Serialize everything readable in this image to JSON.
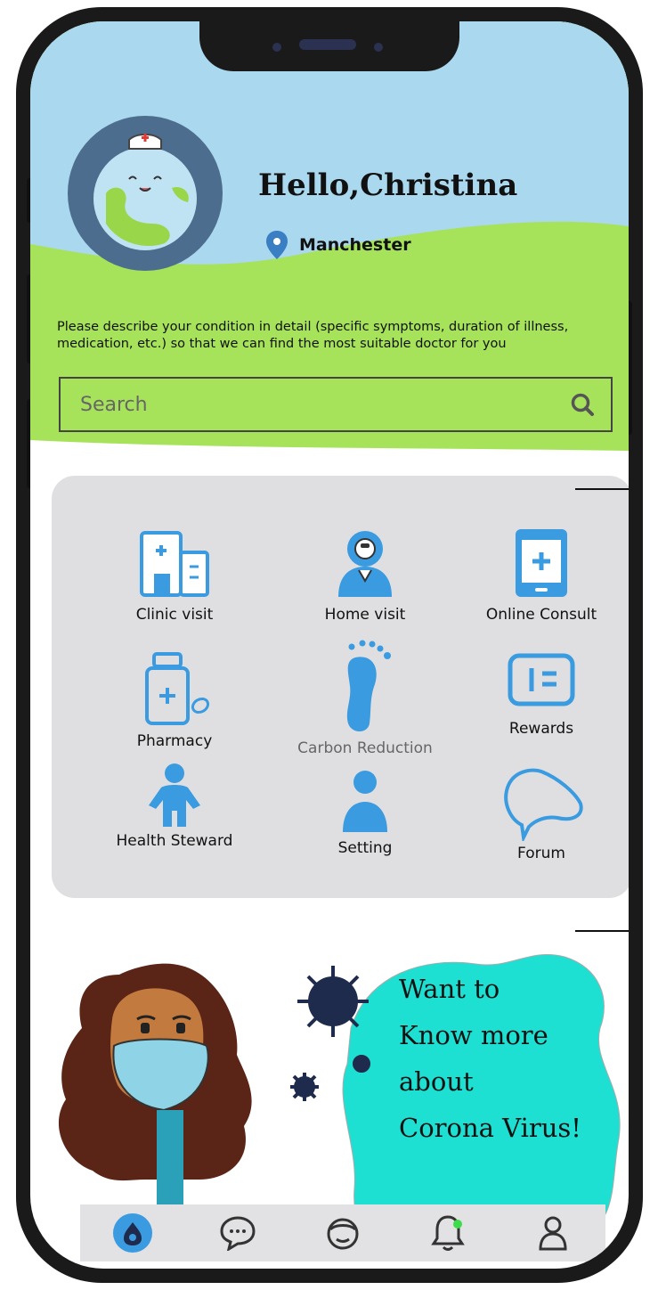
{
  "header": {
    "greeting": "Hello,Christina",
    "location": "Manchester",
    "description": "Please describe your condition in detail (specific symptoms, duration of illness, medication, etc.) so that we can find the most suitable doctor for you"
  },
  "search": {
    "placeholder": "Search"
  },
  "services": [
    {
      "label": "Clinic visit",
      "icon": "clinic-icon"
    },
    {
      "label": "Home visit",
      "icon": "doctor-icon"
    },
    {
      "label": "Online Consult",
      "icon": "tablet-icon"
    },
    {
      "label": "Pharmacy",
      "icon": "medicine-bottle-icon"
    },
    {
      "label": "Carbon Reduction",
      "icon": "footprint-icon"
    },
    {
      "label": "Rewards",
      "icon": "rewards-icon"
    },
    {
      "label": "Health Steward",
      "icon": "person-icon"
    },
    {
      "label": "Setting",
      "icon": "user-icon"
    },
    {
      "label": "Forum",
      "icon": "chat-bubble-icon"
    }
  ],
  "banner": {
    "line1": "Want to",
    "line2": "Know more about",
    "line3": "Corona Virus!"
  },
  "tabs": [
    {
      "name": "home",
      "icon": "home-icon",
      "active": true
    },
    {
      "name": "messages",
      "icon": "message-icon"
    },
    {
      "name": "profile-face",
      "icon": "face-icon"
    },
    {
      "name": "notifications",
      "icon": "bell-icon"
    },
    {
      "name": "account",
      "icon": "account-icon"
    }
  ],
  "colors": {
    "sky": "#a9d8ef",
    "grass": "#a6e35a",
    "accent_blue": "#3a9be0",
    "panel": "#dfdfe1",
    "banner_teal": "#1de0d2"
  }
}
